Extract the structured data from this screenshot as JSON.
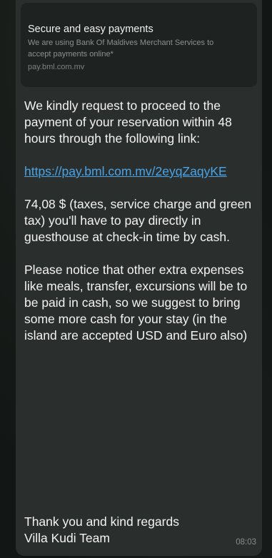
{
  "link_preview": {
    "title": "Secure and easy payments",
    "description": "We are using Bank Of Maldives Merchant Services to accept payments online*",
    "domain": "pay.bml.com.mv"
  },
  "message": {
    "paragraph_1": "We kindly request to proceed to the payment of your reservation within 48 hours through the following link:",
    "link": "https://pay.bml.com.mv/2eyqZaqyKE",
    "paragraph_2": "74,08 $ (taxes, service charge and green tax) you'll have to pay directly in guesthouse at check-in time by cash.",
    "paragraph_3": "Please notice that other extra expenses like meals, transfer, excursions will be to be paid in cash, so we suggest to bring some more cash for your stay (in the island are accepted USD and Euro also)",
    "closing_1": "Thank you and kind regards",
    "closing_2": "Villa Kudi Team",
    "timestamp": "08:03"
  }
}
